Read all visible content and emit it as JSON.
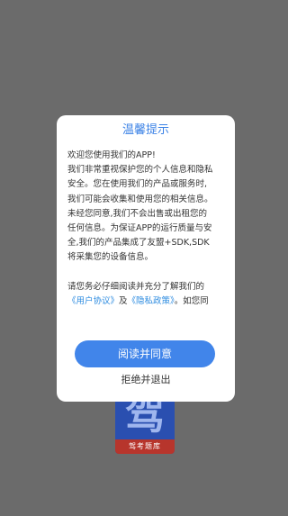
{
  "app_icon": {
    "glyph": "驾",
    "caption": "驾考题库"
  },
  "dialog": {
    "title": "温馨提示",
    "body_lines": [
      "欢迎您使用我们的APP!",
      "我们非常重视保护您的个人信息和隐私",
      "安全。您在使用我们的产品或服务时,",
      "我们可能会收集和使用您的相关信息。",
      "未经您同意,我们不会出售或出租您的",
      "任何信息。为保证APP的运行质量与安",
      "全,我们的产品集成了友盟+SDK,SDK",
      "将采集您的设备信息。"
    ],
    "read_line": "请您务必仔细阅读并充分了解我们的",
    "user_agreement_link": "《用户协议》",
    "and_text": "及",
    "privacy_policy_link": "《隐私政策》",
    "tail_text": "。如您同",
    "agree_label": "阅读并同意",
    "reject_label": "拒绝并退出"
  },
  "colors": {
    "overlay": "#6b6b6b",
    "accent": "#4185ea",
    "title": "#3b82e6",
    "link": "#2c8be0"
  }
}
